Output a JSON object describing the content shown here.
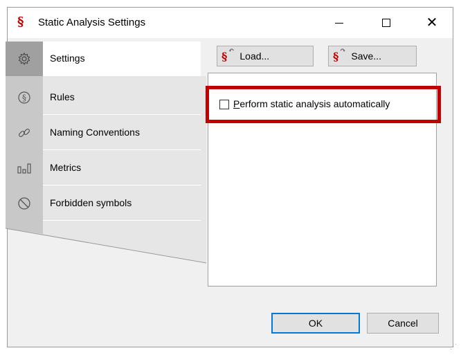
{
  "window": {
    "title": "Static Analysis Settings",
    "app_icon": "§",
    "accent_color": "#c00000"
  },
  "sidebar": {
    "items": [
      {
        "label": "Settings",
        "icon": "gear-icon",
        "selected": true
      },
      {
        "label": "Rules",
        "icon": "section-sign-icon",
        "selected": false
      },
      {
        "label": "Naming Conventions",
        "icon": "link-icon",
        "selected": false
      },
      {
        "label": "Metrics",
        "icon": "metrics-bars-icon",
        "selected": false
      },
      {
        "label": "Forbidden symbols",
        "icon": "prohibited-icon",
        "selected": false
      }
    ]
  },
  "toolbar": {
    "load_label": "Load...",
    "save_label": "Save...",
    "symbol": "§"
  },
  "settings": {
    "auto_analysis_label": "Perform static analysis automatically",
    "auto_analysis_checked": false
  },
  "footer": {
    "ok_label": "OK",
    "cancel_label": "Cancel"
  }
}
